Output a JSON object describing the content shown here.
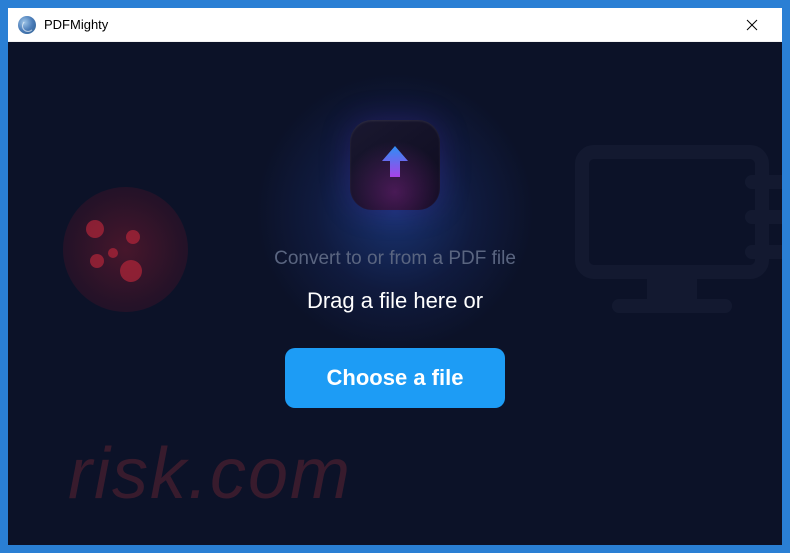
{
  "window": {
    "title": "PDFMighty"
  },
  "main": {
    "subtitle": "Convert to or from a PDF file",
    "drag_text": "Drag a file here or",
    "choose_button_label": "Choose a file"
  },
  "watermark": {
    "text": "risk.com"
  },
  "colors": {
    "accent_button": "#1d9cf5",
    "background_dark": "#0c1228",
    "outer_frame": "#2a7fd4"
  }
}
